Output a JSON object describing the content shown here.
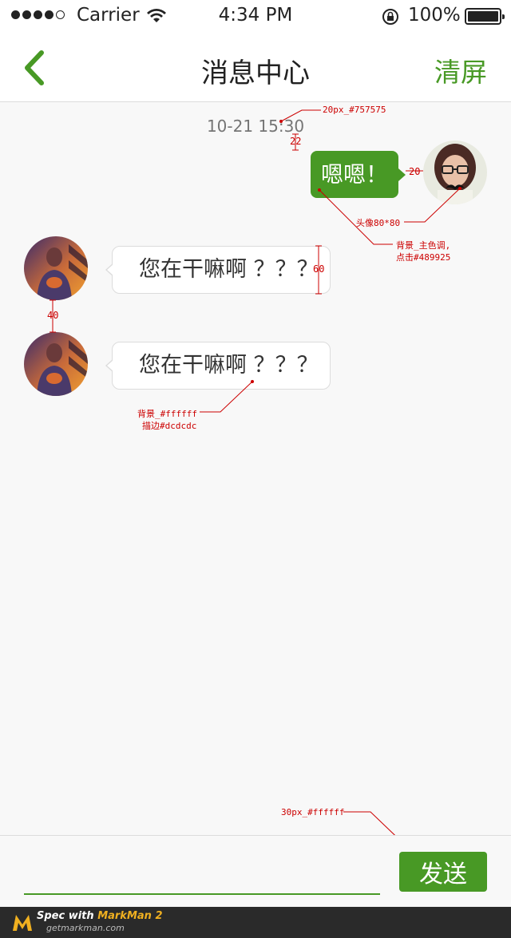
{
  "status_bar": {
    "carrier": "Carrier",
    "time": "4:34 PM",
    "battery": "100%",
    "signal_dots_filled": 4,
    "signal_dots_total": 5
  },
  "nav": {
    "title": "消息中心",
    "right_action": "清屏",
    "back_icon": "chevron-left-icon"
  },
  "chat": {
    "timestamp": "10-21  15:30",
    "messages": [
      {
        "from": "self",
        "text": "嗯嗯！"
      },
      {
        "from": "other",
        "text": "您在干嘛啊 ？？？"
      },
      {
        "from": "other",
        "text": "您在干嘛啊 ？？？"
      }
    ]
  },
  "annotations": {
    "timestamp_spec": "20px_#757575",
    "gap_22": "22",
    "gap_20": "20",
    "avatar_spec": "头像80*80",
    "self_bubble_spec_1": "背景_主色调,",
    "self_bubble_spec_2": "点击#489925",
    "height_60": "60",
    "gap_40": "40",
    "other_bubble_spec_1": "背景_#ffffff",
    "other_bubble_spec_2": "描边#dcdcdc",
    "send_spec": "30px_#ffffff"
  },
  "input_bar": {
    "value": "",
    "send_label": "发送"
  },
  "footer": {
    "spec_prefix": "Spec with ",
    "spec_brand": "MarkMan 2",
    "site": "getmarkman.com"
  },
  "colors": {
    "accent": "#489925",
    "bubble_border": "#dcdcdc",
    "timestamp": "#757575",
    "background": "#f8f8f8"
  }
}
